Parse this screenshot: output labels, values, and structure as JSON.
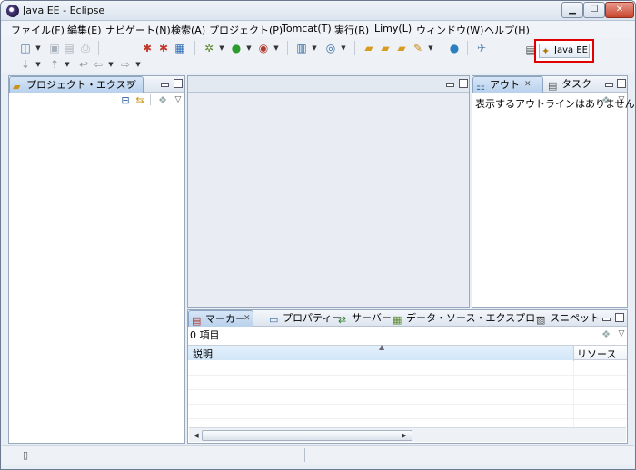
{
  "window": {
    "title": "Java EE - Eclipse"
  },
  "menu": [
    "ファイル(F)",
    "編集(E)",
    "ナビゲート(N)",
    "検索(A)",
    "プロジェクト(P)",
    "Tomcat(T)",
    "実行(R)",
    "Limy(L)",
    "ウィンドウ(W)",
    "ヘルプ(H)"
  ],
  "toolbar": {
    "perspective_label": "Java EE"
  },
  "project_explorer": {
    "tab_label": "プロジェクト・エクスプ"
  },
  "outline": {
    "tabs": [
      "アウト",
      "タスク"
    ],
    "message": "表示するアウトラインはありません。"
  },
  "bottom_panel": {
    "tabs": [
      "マーカー",
      "プロパティー",
      "サーバー",
      "データ・ソース・エクスプロー",
      "スニペット"
    ],
    "count_text": "0 項目",
    "columns": [
      "説明",
      "リソース"
    ]
  }
}
